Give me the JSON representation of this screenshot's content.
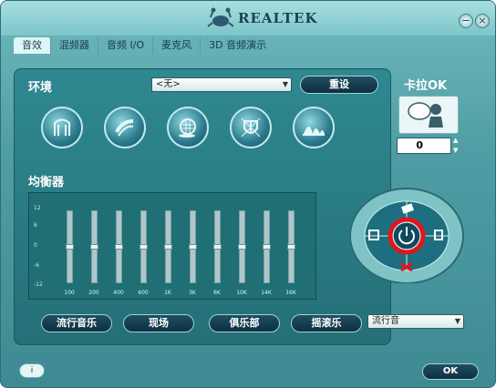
{
  "brand": {
    "name": "REALTEK"
  },
  "window_buttons": {
    "minimize": "−",
    "close": "×"
  },
  "tabs": [
    {
      "label": "音效",
      "active": true
    },
    {
      "label": "混频器",
      "active": false
    },
    {
      "label": "音频 I/O",
      "active": false
    },
    {
      "label": "麦克风",
      "active": false
    },
    {
      "label": "3D 音频演示",
      "active": false
    }
  ],
  "environment": {
    "label": "环境",
    "selected": "<无>",
    "reset_label": "重设",
    "presets": [
      "underwater-icon",
      "pipe-icon",
      "stone-corridor-icon",
      "coliseum-icon",
      "opera-house-icon"
    ]
  },
  "karaoke": {
    "label": "卡拉OK",
    "value": "0"
  },
  "equalizer": {
    "label": "均衡器",
    "scale": [
      "12",
      "6",
      "0",
      "-6",
      "-12"
    ],
    "bands": [
      "100",
      "200",
      "400",
      "600",
      "1K",
      "3K",
      "6K",
      "10K",
      "14K",
      "16K"
    ],
    "levels": [
      0,
      0,
      0,
      0,
      0,
      0,
      0,
      0,
      0,
      0
    ],
    "presets": [
      "流行音乐",
      "现场",
      "俱乐部",
      "摇滚乐"
    ],
    "preset_select": "流行音"
  },
  "ok_label": "OK",
  "info_label": "i"
}
